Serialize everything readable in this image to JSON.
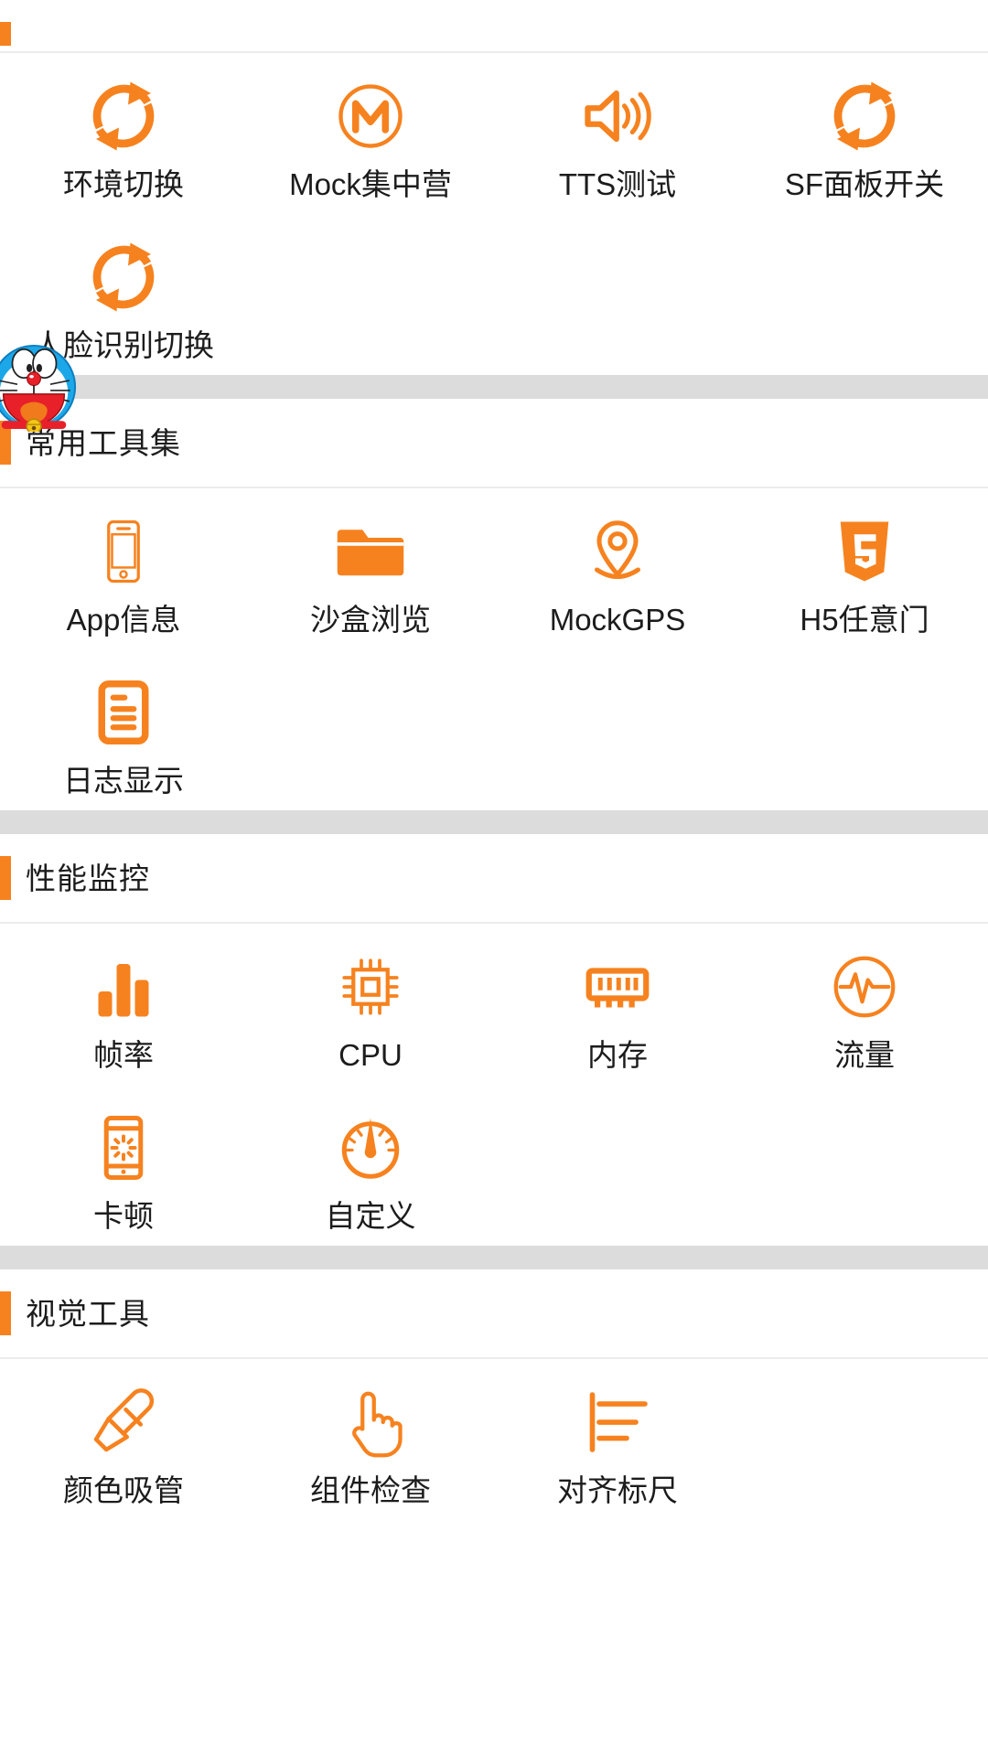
{
  "theme": {
    "accent": "#f6821f",
    "text": "#1c1c1c",
    "divider": "#ececec",
    "band": "#dcdcdc",
    "background": "#ffffff"
  },
  "floating_assistant": {
    "name": "doraemon-assistant-ball",
    "icon": "doraemon-face-icon"
  },
  "sections": [
    {
      "id": "env-tools",
      "title": "",
      "title_visible": false,
      "items": [
        {
          "label": "环境切换",
          "icon": "sync-refresh-icon"
        },
        {
          "label": "Mock集中营",
          "icon": "mock-m-circle-icon"
        },
        {
          "label": "TTS测试",
          "icon": "speaker-volume-icon"
        },
        {
          "label": "SF面板开关",
          "icon": "sync-refresh-icon"
        },
        {
          "label": "人脸识别切换",
          "icon": "sync-refresh-icon"
        }
      ]
    },
    {
      "id": "common-tools",
      "title": "常用工具集",
      "title_visible": true,
      "items": [
        {
          "label": "App信息",
          "icon": "phone-outline-icon"
        },
        {
          "label": "沙盒浏览",
          "icon": "folder-filled-icon"
        },
        {
          "label": "MockGPS",
          "icon": "map-pin-icon"
        },
        {
          "label": "H5任意门",
          "icon": "html5-shield-icon"
        },
        {
          "label": "日志显示",
          "icon": "document-lines-icon"
        }
      ]
    },
    {
      "id": "performance-monitor",
      "title": "性能监控",
      "title_visible": true,
      "items": [
        {
          "label": "帧率",
          "icon": "bar-chart-icon"
        },
        {
          "label": "CPU",
          "icon": "cpu-chip-icon"
        },
        {
          "label": "内存",
          "icon": "memory-ram-icon"
        },
        {
          "label": "流量",
          "icon": "pulse-circle-icon"
        },
        {
          "label": "卡顿",
          "icon": "phone-spinner-icon"
        },
        {
          "label": "自定义",
          "icon": "gauge-speedometer-icon"
        }
      ]
    },
    {
      "id": "visual-tools",
      "title": "视觉工具",
      "title_visible": true,
      "items": [
        {
          "label": "颜色吸管",
          "icon": "eyedropper-icon"
        },
        {
          "label": "组件检查",
          "icon": "pointing-hand-icon"
        },
        {
          "label": "对齐标尺",
          "icon": "align-ruler-icon"
        }
      ]
    }
  ]
}
